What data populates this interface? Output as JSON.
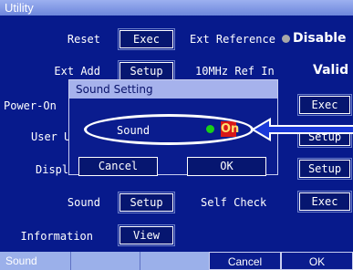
{
  "window": {
    "title": "Utility"
  },
  "rows": {
    "reset": {
      "label": "Reset",
      "button": "Exec"
    },
    "ext_ref": {
      "label": "Ext Reference",
      "value": "Disable"
    },
    "ext_add": {
      "label": "Ext Add",
      "button": "Setup"
    },
    "ref_in": {
      "label": "10MHz Ref In",
      "value": "Valid"
    },
    "power_on": {
      "label": "Power-On",
      "button": "Exec"
    },
    "user": {
      "label": "User U",
      "button": "Setup"
    },
    "display": {
      "label": "Displa",
      "button": "Setup"
    },
    "sound": {
      "label": "Sound",
      "button": "Setup"
    },
    "self_check": {
      "label": "Self Check",
      "button": "Exec"
    },
    "information": {
      "label": "Information",
      "button": "View"
    }
  },
  "dialog": {
    "title": "Sound Setting",
    "field_label": "Sound",
    "field_value": "On",
    "cancel": "Cancel",
    "ok": "OK"
  },
  "softkeys": {
    "k1": "Sound",
    "k2": "",
    "k3": "",
    "k4": "Cancel",
    "k5": "OK"
  },
  "colors": {
    "background": "#071a8c",
    "indicator_on": "#18d018",
    "indicator_off": "#a8a8a8",
    "highlight_on": "#d81818",
    "arrow": "#1a38d8"
  }
}
